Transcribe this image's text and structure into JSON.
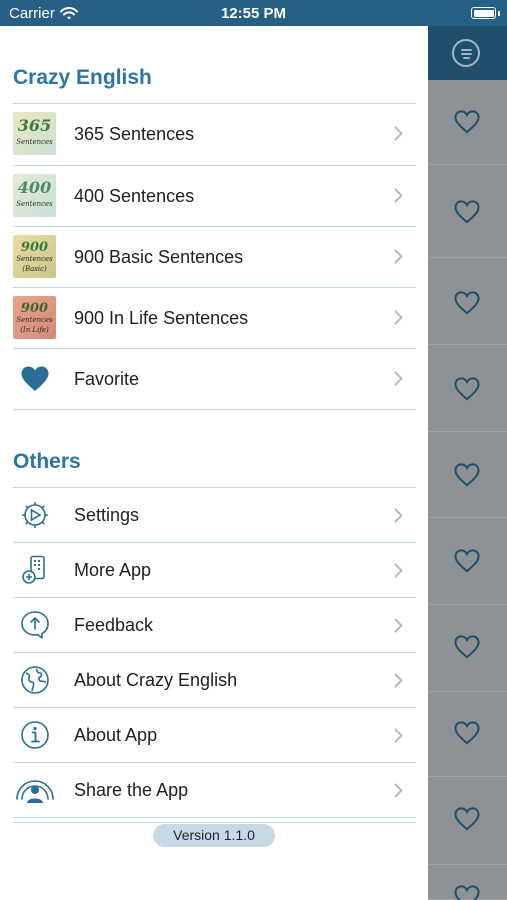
{
  "status_bar": {
    "carrier": "Carrier",
    "time": "12:55 PM"
  },
  "main": {
    "favorite_rows": 9
  },
  "sections": {
    "crazy_english": {
      "title": "Crazy English",
      "items": [
        {
          "label": "365 Sentences",
          "thumb_text": "365",
          "thumb_sub": "Sentences"
        },
        {
          "label": "400 Sentences",
          "thumb_text": "400",
          "thumb_sub": "Sentences"
        },
        {
          "label": "900 Basic Sentences",
          "thumb_text": "900",
          "thumb_sub": "Basic"
        },
        {
          "label": "900 In Life Sentences",
          "thumb_text": "900",
          "thumb_sub": "In Life"
        },
        {
          "label": "Favorite",
          "icon": "heart-icon"
        }
      ]
    },
    "others": {
      "title": "Others",
      "items": [
        {
          "label": "Settings",
          "icon": "settings-gear-icon"
        },
        {
          "label": "More App",
          "icon": "more-app-icon"
        },
        {
          "label": "Feedback",
          "icon": "feedback-icon"
        },
        {
          "label": "About Crazy English",
          "icon": "globe-icon"
        },
        {
          "label": "About App",
          "icon": "info-icon"
        },
        {
          "label": "Share the App",
          "icon": "share-person-icon"
        }
      ]
    }
  },
  "footer": {
    "version": "Version 1.1.0"
  },
  "colors": {
    "accent": "#2b76a6",
    "status_bar": "#275f85",
    "nav_dark": "#1f4f6d",
    "overlay": "#8e9294"
  }
}
